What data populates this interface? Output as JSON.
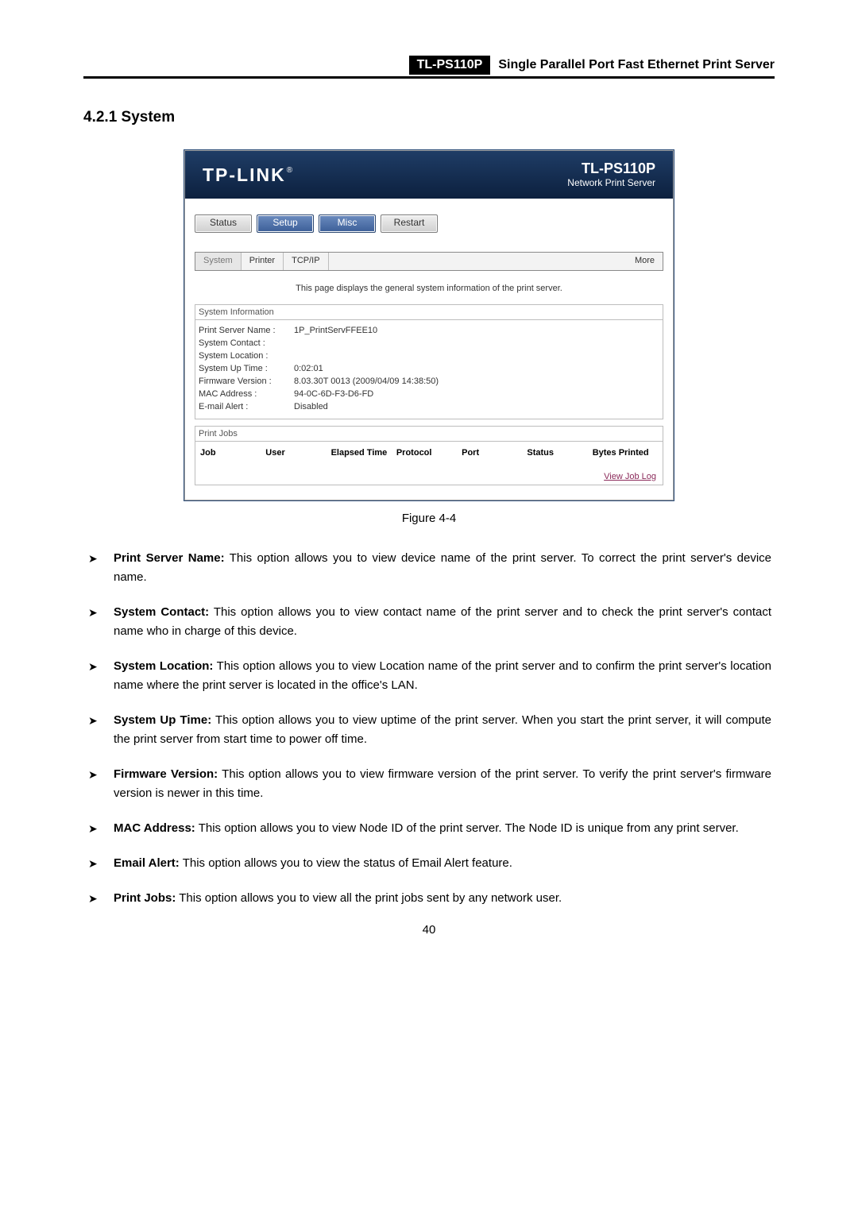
{
  "doc_header": {
    "model": "TL-PS110P",
    "title": "Single Parallel Port Fast Ethernet Print Server"
  },
  "section_heading": "4.2.1  System",
  "figure": {
    "brand": "TP-LINK",
    "head_model": "TL-PS110P",
    "head_subtitle": "Network Print Server",
    "main_tabs": {
      "status": "Status",
      "setup": "Setup",
      "misc": "Misc",
      "restart": "Restart"
    },
    "sub_tabs": {
      "system": "System",
      "printer": "Printer",
      "tcpip": "TCP/IP",
      "more": "More"
    },
    "description": "This page displays the general system information of the print server.",
    "system_info_title": "System Information",
    "system_info": [
      {
        "label": "Print Server Name :",
        "value": "1P_PrintServFFEE10"
      },
      {
        "label": "System Contact :",
        "value": ""
      },
      {
        "label": "System Location :",
        "value": ""
      },
      {
        "label": "System Up Time :",
        "value": "0:02:01"
      },
      {
        "label": "Firmware Version :",
        "value": "8.03.30T 0013 (2009/04/09 14:38:50)"
      },
      {
        "label": "MAC Address :",
        "value": "94-0C-6D-F3-D6-FD"
      },
      {
        "label": "E-mail Alert :",
        "value": "Disabled"
      }
    ],
    "print_jobs_title": "Print Jobs",
    "print_jobs_cols": {
      "job": "Job",
      "user": "User",
      "elapsed": "Elapsed Time",
      "protocol": "Protocol",
      "port": "Port",
      "status": "Status",
      "bytes": "Bytes Printed"
    },
    "view_job_log": "View Job Log"
  },
  "figure_caption": "Figure 4-4",
  "bullets": [
    {
      "head": "Print Server Name:",
      "body": " This option allows you to view device name of the print server. To correct the print server's device name."
    },
    {
      "head": "System Contact:",
      "body": " This option allows you to view contact name of the print server and to check the print server's contact name who in charge of this device."
    },
    {
      "head": "System Location:",
      "body": " This option allows you to view Location name of the print server and to confirm the print server's location name where the print server is located in the office's LAN."
    },
    {
      "head": "System Up Time:",
      "body": " This option allows you to view uptime of the print server. When you start the print server, it will compute the print server from start time to power off time."
    },
    {
      "head": "Firmware Version:",
      "body": " This option allows you to view firmware version of the print server. To verify the print server's firmware version is newer in this time."
    },
    {
      "head": "MAC Address:",
      "body": " This option allows you to view Node ID of the print server. The Node ID is unique from any print server."
    },
    {
      "head": "Email Alert:",
      "body": " This option allows you to view the status of Email Alert feature."
    },
    {
      "head": "Print Jobs:",
      "body": " This option allows you to view all the print jobs sent by any network user."
    }
  ],
  "page_number": "40"
}
